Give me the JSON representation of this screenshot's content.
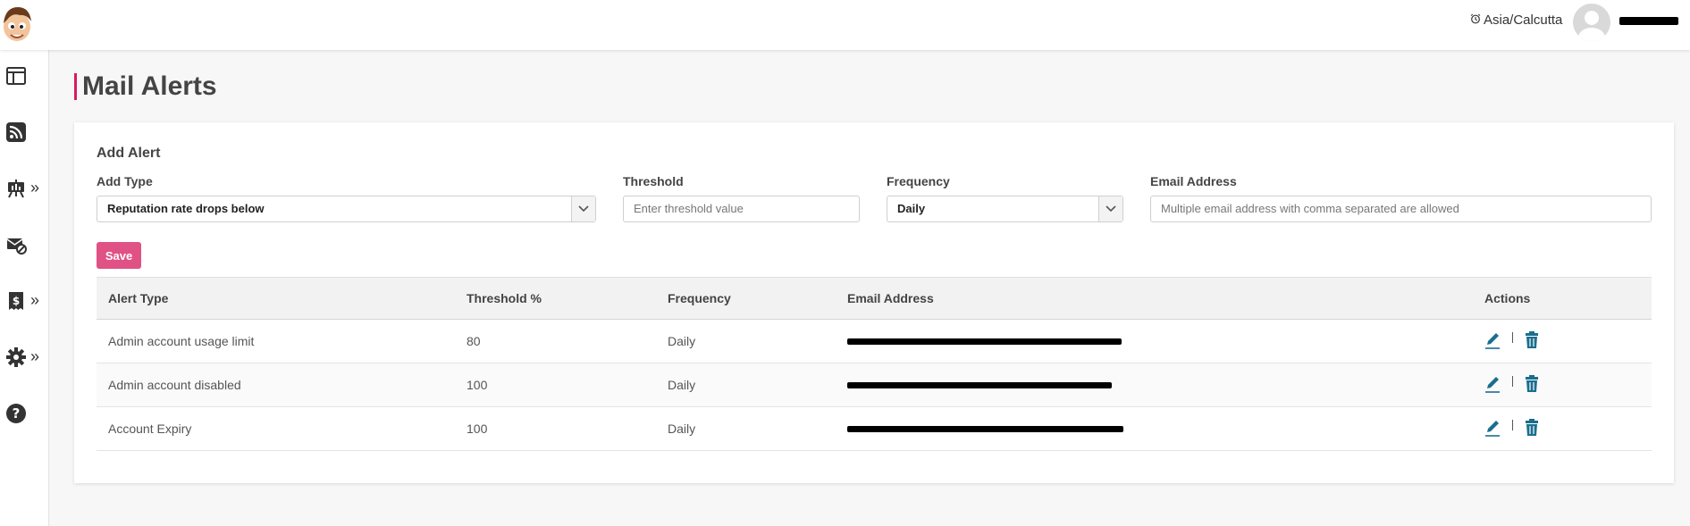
{
  "header": {
    "timezone": "Asia/Calcutta"
  },
  "sidebar": {
    "items": [
      {
        "icon": "dashboard-icon",
        "has_submenu": false
      },
      {
        "icon": "rss-icon",
        "has_submenu": false
      },
      {
        "icon": "campaign-icon",
        "has_submenu": true
      },
      {
        "icon": "mail-blocked-icon",
        "has_submenu": false
      },
      {
        "icon": "billing-icon",
        "has_submenu": true
      },
      {
        "icon": "gear-icon",
        "has_submenu": true
      },
      {
        "icon": "help-icon",
        "has_submenu": false
      }
    ],
    "submenu_glyph": "»"
  },
  "page": {
    "title": "Mail Alerts"
  },
  "form": {
    "title": "Add Alert",
    "add_type": {
      "label": "Add Type",
      "value": "Reputation rate drops below"
    },
    "threshold": {
      "label": "Threshold",
      "placeholder": "Enter threshold value"
    },
    "frequency": {
      "label": "Frequency",
      "value": "Daily"
    },
    "email": {
      "label": "Email Address",
      "placeholder": "Multiple email address with comma separated are allowed"
    },
    "save_label": "Save"
  },
  "table": {
    "columns": [
      "Alert Type",
      "Threshold %",
      "Frequency",
      "Email Address",
      "Actions"
    ],
    "rows": [
      {
        "alert_type": "Admin account usage limit",
        "threshold": "80",
        "frequency": "Daily"
      },
      {
        "alert_type": "Admin account disabled",
        "threshold": "100",
        "frequency": "Daily"
      },
      {
        "alert_type": "Account Expiry",
        "threshold": "100",
        "frequency": "Daily"
      }
    ]
  },
  "colors": {
    "accent": "#d81b60",
    "save_button": "#e05185",
    "action_icons": "#1a6e8e"
  }
}
